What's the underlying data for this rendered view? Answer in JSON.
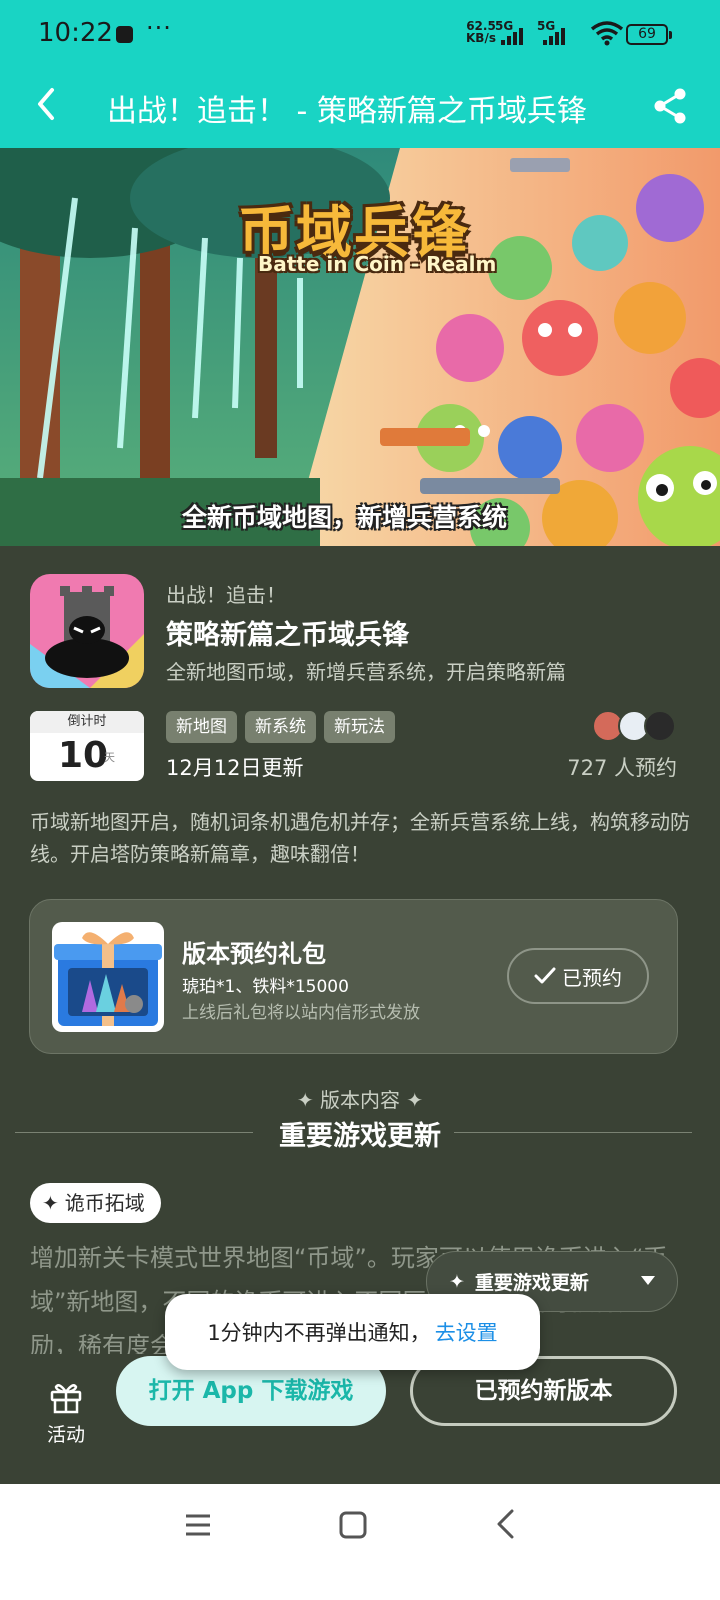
{
  "status_bar": {
    "time": "10:22",
    "more": "···",
    "net_speed_value": "62.5",
    "net_speed_unit": "KB/s",
    "sim1": "5G",
    "sim2": "5G",
    "battery": "69"
  },
  "header": {
    "title": "出战！追击！ - 策略新篇之币域兵锋",
    "back_icon": "chevron-left-icon",
    "share_icon": "share-icon"
  },
  "banner": {
    "logo_cn": "币域兵锋",
    "logo_en": "Batte in Coin - Realm",
    "caption": "全新币域地图，新增兵营系统"
  },
  "game": {
    "kicker": "出战！追击！",
    "name": "策略新篇之币域兵锋",
    "desc": "全新地图币域，新增兵营系统，开启策略新篇",
    "countdown_label": "倒计时",
    "countdown_value": "10",
    "countdown_unit": "天",
    "tags": [
      "新地图",
      "新系统",
      "新玩法"
    ],
    "update_date": "12月12日更新",
    "reserve_count": "727 人预约",
    "intro": "币域新地图开启，随机词条机遇危机并存；全新兵营系统上线，构筑移动防线。开启塔防策略新篇章，趣味翻倍！"
  },
  "gift": {
    "title": "版本预约礼包",
    "items": "琥珀*1、铁料*15000",
    "note": "上线后礼包将以站内信形式发放",
    "button": "已预约"
  },
  "section": {
    "kicker": "版本内容",
    "title": "重要游戏更新",
    "pill": "诡币拓域",
    "body": "增加新关卡模式世界地图“币域”。玩家可以使用诡币进入“币域”新地图，不同的诡币可进入不同区域，探索后可获得奖励，稀有度会被随机决定，点亮整个世界地图。"
  },
  "floating": {
    "section_nav": "重要游戏更新",
    "toast_text": "1分钟内不再弹出通知，",
    "toast_link": "去设置"
  },
  "bottom": {
    "activity": "活动",
    "open_app": "打开 App 下载游戏",
    "reserved_version": "已预约新版本"
  },
  "colors": {
    "header_bg": "#19d4c4",
    "page_bg": "#3a4235",
    "accent_link": "#1c8fe6",
    "open_btn_text": "#1bb7a9"
  }
}
